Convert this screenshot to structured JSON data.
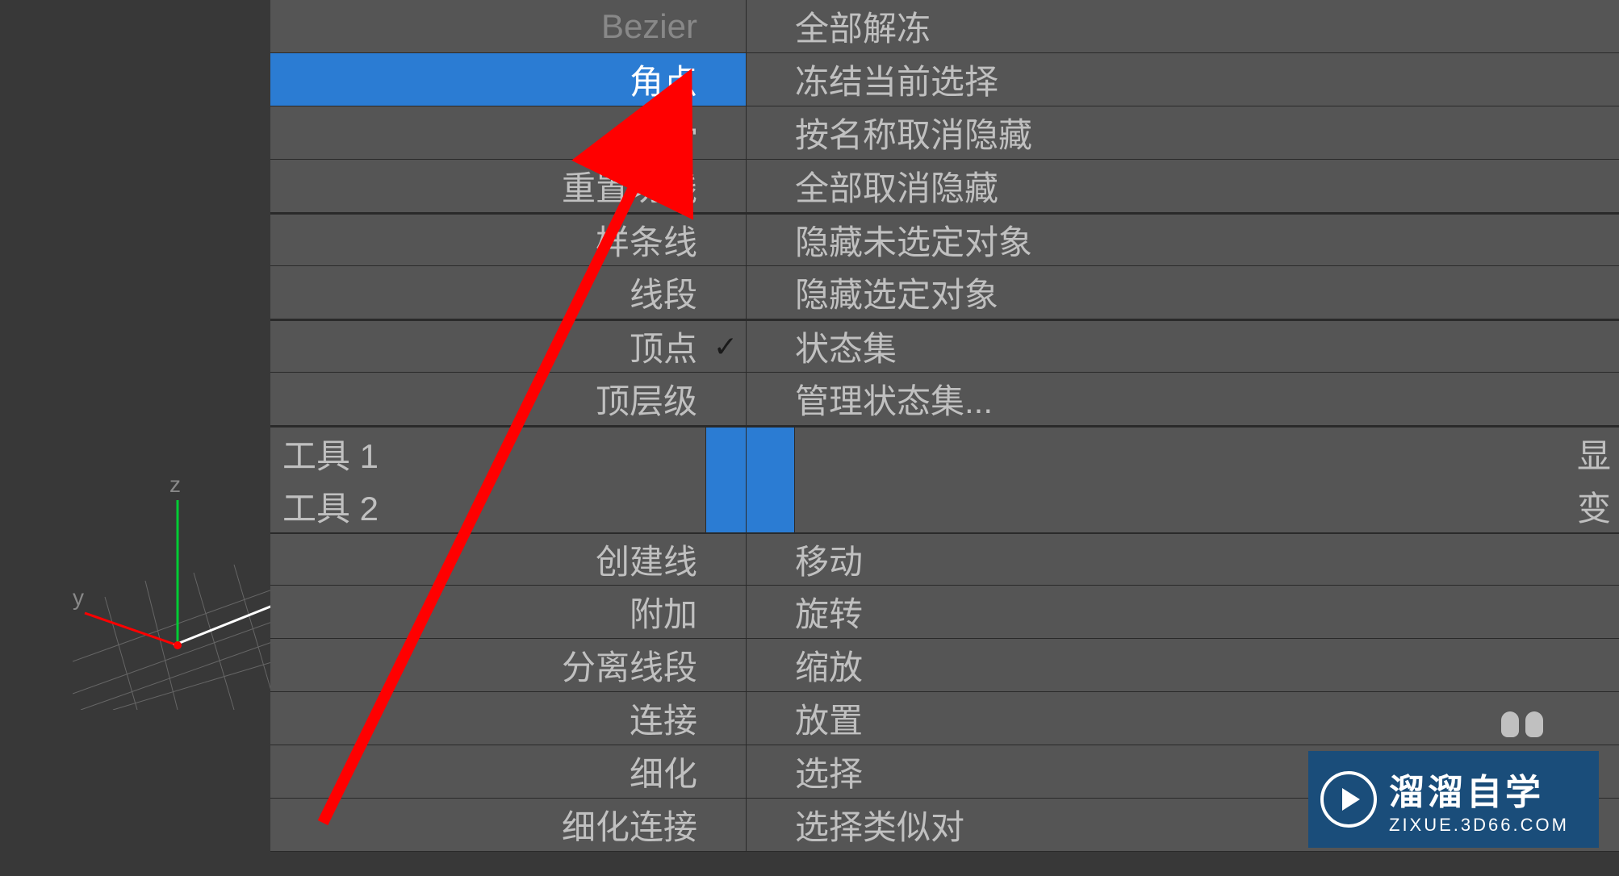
{
  "viewport": {
    "axes": {
      "z": "z",
      "y": "y"
    }
  },
  "menu": {
    "left": [
      {
        "label": "Bezier",
        "selected": false,
        "disabled": true
      },
      {
        "label": "角点",
        "selected": true
      },
      {
        "label": "平滑",
        "selected": false
      },
      {
        "label": "重置切线",
        "selected": false
      },
      {
        "label": "样条线",
        "selected": false
      },
      {
        "label": "线段",
        "selected": false
      },
      {
        "label": "顶点",
        "selected": false,
        "checked": true
      },
      {
        "label": "顶层级",
        "selected": false
      }
    ],
    "right": [
      {
        "label": "全部解冻"
      },
      {
        "label": "冻结当前选择"
      },
      {
        "label": "按名称取消隐藏"
      },
      {
        "label": "全部取消隐藏"
      },
      {
        "label": "隐藏未选定对象"
      },
      {
        "label": "隐藏选定对象"
      },
      {
        "label": "状态集"
      },
      {
        "label": "管理状态集..."
      }
    ],
    "tools": [
      {
        "label": "工具 1",
        "right": "显"
      },
      {
        "label": "工具 2",
        "right": "变"
      }
    ],
    "bottom_left": [
      {
        "label": "创建线"
      },
      {
        "label": "附加"
      },
      {
        "label": "分离线段"
      },
      {
        "label": "连接"
      },
      {
        "label": "细化"
      },
      {
        "label": "细化连接"
      }
    ],
    "bottom_right": [
      {
        "label": "移动"
      },
      {
        "label": "旋转"
      },
      {
        "label": "缩放"
      },
      {
        "label": "放置"
      },
      {
        "label": "选择"
      },
      {
        "label": "选择类似对"
      }
    ]
  },
  "watermark": {
    "title": "溜溜自学",
    "url": "ZIXUE.3D66.COM"
  }
}
